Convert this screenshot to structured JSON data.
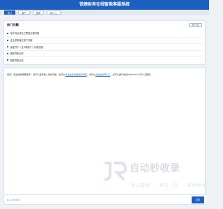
{
  "header": {
    "title": "铁建财务在线智能客服系统"
  },
  "tabs": [
    "热门",
    "客户",
    "需求",
    "转人工"
  ],
  "hot": {
    "title": "热门问题",
    "button": "换一批",
    "items": [
      "电子商业承兑汇票的办理流程",
      "企业重新建立账户流程",
      "远程开户（无U盾用户）办理流程",
      "国家导航业务",
      "国家导航业务"
    ]
  },
  "chat": {
    "msg_prefix": "您好！我是智能客服助手。您可以直接输入您的问题，也可以",
    "link1": "点击此处查看常见问题",
    "msg_mid": "，也可以",
    "link2": "点击此处转人工",
    "msg_suffix": "，还可以拨打电话400611XXX 转人工服务。"
  },
  "watermark": {
    "title": "自动秒收录",
    "subtitle": "快上链接 → 来访一次 → 自动收录"
  },
  "input": {
    "placeholder": "输入您的问题",
    "send": "发送"
  },
  "colors": {
    "primary": "#1d5fbf",
    "background": "#eef1f6"
  }
}
